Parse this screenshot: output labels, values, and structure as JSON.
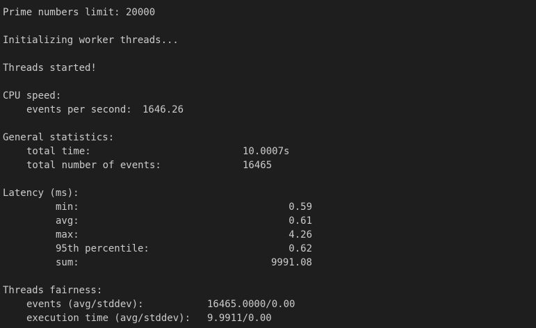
{
  "lines": {
    "prime_limit": "Prime numbers limit: 20000",
    "init": "Initializing worker threads...",
    "started": "Threads started!"
  },
  "cpu": {
    "header": "CPU speed:",
    "eps_label": "events per second:",
    "eps_value": "1646.26"
  },
  "general": {
    "header": "General statistics:",
    "total_time_label": "total time:",
    "total_time_value": "10.0007s",
    "total_events_label": "total number of events:",
    "total_events_value": "16465"
  },
  "latency": {
    "header": "Latency (ms):",
    "rows": [
      {
        "label": "min:",
        "value": "0.59"
      },
      {
        "label": "avg:",
        "value": "0.61"
      },
      {
        "label": "max:",
        "value": "4.26"
      },
      {
        "label": "95th percentile:",
        "value": "0.62"
      },
      {
        "label": "sum:",
        "value": "9991.08"
      }
    ]
  },
  "fairness": {
    "header": "Threads fairness:",
    "events_label": "events (avg/stddev):",
    "events_value": "16465.0000/0.00",
    "exec_label": "execution time (avg/stddev):",
    "exec_value": "9.9911/0.00"
  }
}
